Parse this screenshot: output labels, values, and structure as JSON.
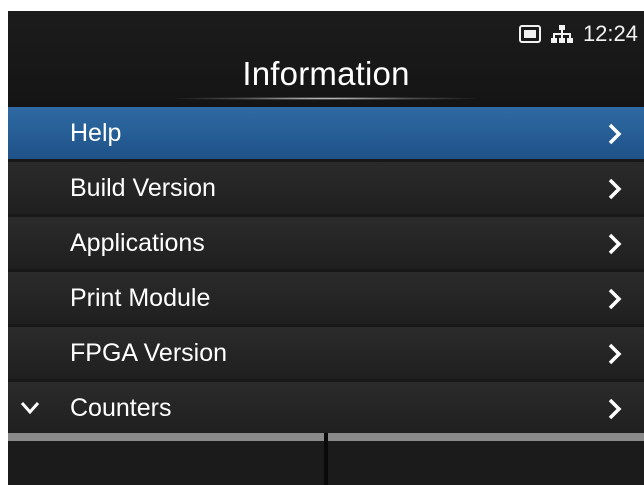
{
  "status": {
    "time": "12:24",
    "icons": [
      "sd-card-icon",
      "network-icon"
    ]
  },
  "header": {
    "title": "Information"
  },
  "menu": {
    "items": [
      {
        "label": "Help",
        "selected": true
      },
      {
        "label": "Build Version"
      },
      {
        "label": "Applications"
      },
      {
        "label": "Print Module"
      },
      {
        "label": "FPGA Version"
      },
      {
        "label": "Counters",
        "has_more_below": true
      }
    ]
  },
  "softkeys": {
    "left": "",
    "right": ""
  },
  "colors": {
    "selected_row": "#1e5288",
    "background": "#181818"
  }
}
